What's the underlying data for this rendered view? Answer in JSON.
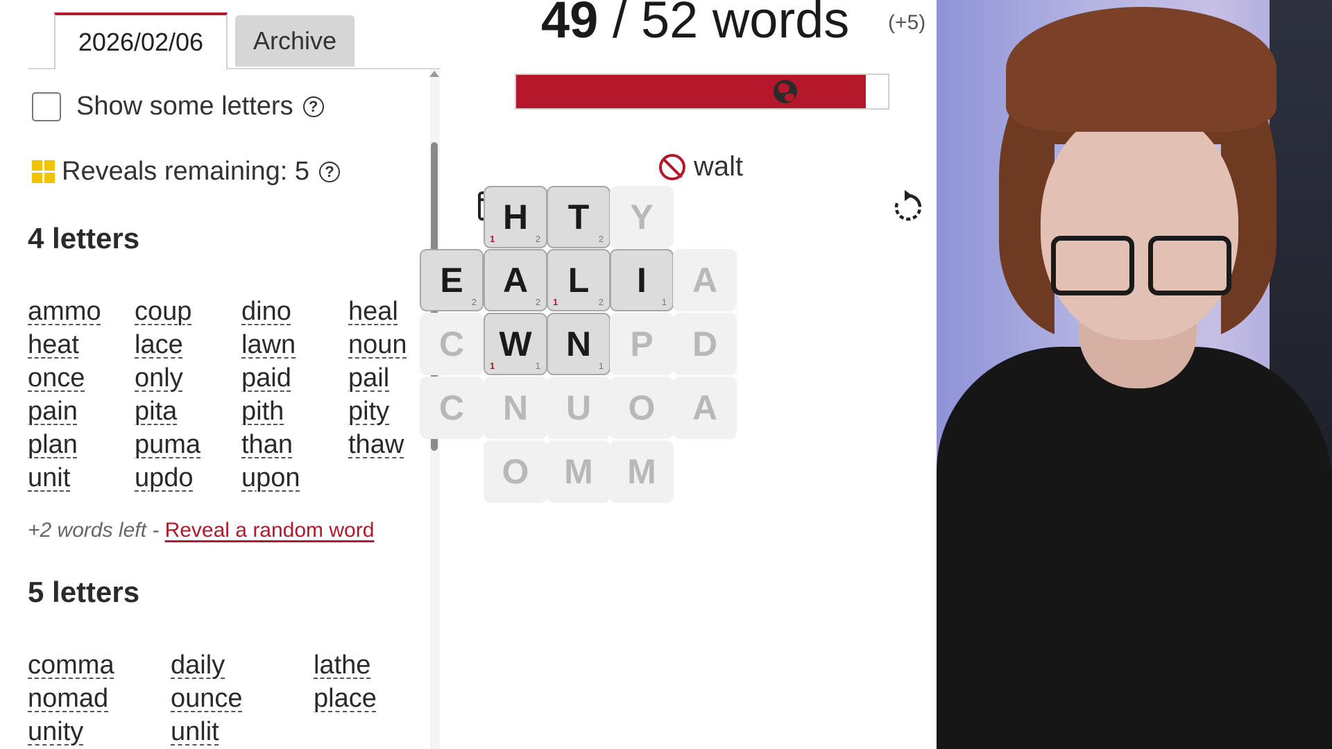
{
  "left": {
    "tabs": {
      "today": "2026/02/06",
      "archive": "Archive"
    },
    "show_letters": "Show some letters",
    "reveals": "Reveals remaining: 5",
    "help_glyph": "?",
    "section4": {
      "title": "4 letters",
      "words": [
        "ammo",
        "coup",
        "dino",
        "heal",
        "heat",
        "lace",
        "lawn",
        "noun",
        "once",
        "only",
        "paid",
        "pail",
        "pain",
        "pita",
        "pith",
        "pity",
        "plan",
        "puma",
        "than",
        "thaw",
        "unit",
        "updo",
        "upon"
      ]
    },
    "words_left": "+2 words left - ",
    "reveal_link": "Reveal a random word",
    "section5": {
      "title": "5 letters",
      "words": [
        "comma",
        "daily",
        "lathe",
        "nomad",
        "ounce",
        "place",
        "unity",
        "unlit"
      ]
    }
  },
  "game": {
    "found": "49",
    "sep": " / ",
    "total_text": "52 words",
    "bonus": "(+5)",
    "progress_fraction": 0.94,
    "invalid_word": "walt",
    "tiles": [
      {
        "letter": "H",
        "used": true,
        "count_left": "1",
        "count_right": "2"
      },
      {
        "letter": "T",
        "used": true,
        "count_left": "",
        "count_right": "2"
      },
      {
        "letter": "Y",
        "used": false,
        "count_left": "",
        "count_right": ""
      },
      {
        "letter": "E",
        "used": true,
        "count_left": "",
        "count_right": "2"
      },
      {
        "letter": "A",
        "used": true,
        "count_left": "",
        "count_right": "2"
      },
      {
        "letter": "L",
        "used": true,
        "count_left": "1",
        "count_right": "2"
      },
      {
        "letter": "I",
        "used": true,
        "count_left": "",
        "count_right": "1"
      },
      {
        "letter": "A",
        "used": false,
        "count_left": "",
        "count_right": ""
      },
      {
        "letter": "C",
        "used": false,
        "count_left": "",
        "count_right": ""
      },
      {
        "letter": "W",
        "used": true,
        "count_left": "1",
        "count_right": "1"
      },
      {
        "letter": "N",
        "used": true,
        "count_left": "",
        "count_right": "1"
      },
      {
        "letter": "P",
        "used": false,
        "count_left": "",
        "count_right": ""
      },
      {
        "letter": "D",
        "used": false,
        "count_left": "",
        "count_right": ""
      },
      {
        "letter": "C",
        "used": false,
        "count_left": "",
        "count_right": ""
      },
      {
        "letter": "N",
        "used": false,
        "count_left": "",
        "count_right": ""
      },
      {
        "letter": "U",
        "used": false,
        "count_left": "",
        "count_right": ""
      },
      {
        "letter": "O",
        "used": false,
        "count_left": "",
        "count_right": ""
      },
      {
        "letter": "A",
        "used": false,
        "count_left": "",
        "count_right": ""
      },
      {
        "letter": "O",
        "used": false,
        "count_left": "",
        "count_right": ""
      },
      {
        "letter": "M",
        "used": false,
        "count_left": "",
        "count_right": ""
      },
      {
        "letter": "M",
        "used": false,
        "count_left": "",
        "count_right": ""
      }
    ]
  },
  "colors": {
    "accent": "#b5182b",
    "reveal_yellow": "#f2c400"
  },
  "icons": [
    "help-icon",
    "reveal-grid-icon",
    "globe-icon",
    "no-entry-icon",
    "calendar-undo-icon",
    "refresh-icon"
  ]
}
